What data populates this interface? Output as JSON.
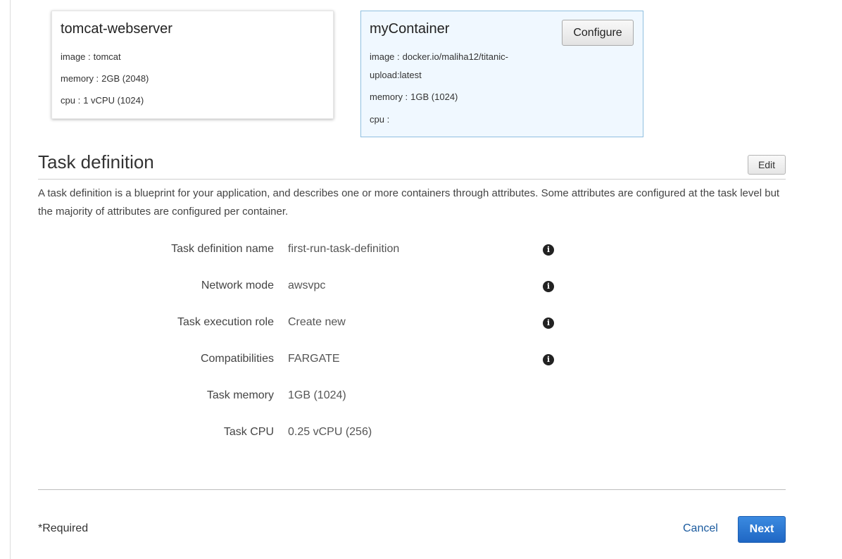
{
  "containers": [
    {
      "name": "tomcat-webserver",
      "image_label": "image :",
      "image": "tomcat",
      "memory_label": "memory :",
      "memory": "2GB (2048)",
      "cpu_label": "cpu :",
      "cpu": "1 vCPU (1024)"
    },
    {
      "name": "myContainer",
      "configure_label": "Configure",
      "image_label": "image :",
      "image_line1": "docker.io/maliha12/titanic-",
      "image_line2": "upload:latest",
      "memory_label": "memory :",
      "memory": "1GB (1024)",
      "cpu_label": "cpu :",
      "cpu": ""
    }
  ],
  "task_definition": {
    "title": "Task definition",
    "edit_label": "Edit",
    "description": "A task definition is a blueprint for your application, and describes one or more containers through attributes. Some attributes are configured at the task level but the majority of attributes are configured per container.",
    "properties": [
      {
        "label": "Task definition name",
        "value": "first-run-task-definition",
        "info_icon": "info-circle-icon"
      },
      {
        "label": "Network mode",
        "value": "awsvpc",
        "info_icon": "info-circle-icon"
      },
      {
        "label": "Task execution role",
        "value": "Create new",
        "info_icon": "info-circle-icon"
      },
      {
        "label": "Compatibilities",
        "value": "FARGATE",
        "info_icon": "info-circle-icon"
      },
      {
        "label": "Task memory",
        "value": "1GB (1024)"
      },
      {
        "label": "Task CPU",
        "value": "0.25 vCPU (256)"
      }
    ]
  },
  "footer": {
    "required_note": "*Required",
    "cancel_label": "Cancel",
    "next_label": "Next"
  },
  "colors": {
    "primary_button": "#1f67c4",
    "link": "#1a5a9e",
    "selected_card_bg": "#f0f8ff",
    "selected_card_border": "#8fbfe0"
  }
}
